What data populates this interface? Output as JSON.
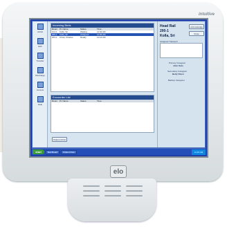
{
  "device": {
    "brand": "elo",
    "model_label": "intuitive"
  },
  "sidebar": {
    "items": [
      {
        "label": "Admit"
      },
      {
        "label": "Edit"
      },
      {
        "label": "Transfer"
      },
      {
        "label": "Discharge"
      },
      {
        "label": "Census"
      },
      {
        "label": "Help"
      }
    ]
  },
  "upper_pane": {
    "header": "Incoming Beds",
    "columns": [
      "Room",
      "Pt. Name",
      "Status",
      "Time"
    ],
    "rows": [
      [
        "101-1",
        "Kolla, Sri",
        "Waiting",
        "11:02 AM"
      ],
      [
        "200-1",
        "Kolla, Sri",
        "Assigned",
        "11:05 AM"
      ],
      [
        "201-1",
        "Chow, Charles",
        "Ready",
        "11:14 AM"
      ]
    ],
    "selected_row": 1
  },
  "lower_pane": {
    "header": "Encounter List",
    "columns": [
      "Room",
      "Pt. Name",
      "Status",
      "Time"
    ]
  },
  "bottom_button": "Patient Admit",
  "detail": {
    "unit": "Head Rail",
    "bed": "200-1",
    "patient": "Kolla, Sri",
    "acknowledge_button": "Acknowledge",
    "close_button": "Close",
    "assigned_label": "Assigned Transport",
    "primary_label": "Primary Caregiver",
    "primary_name": "John Kato",
    "secondary_label": "Secondary Caregiver",
    "secondary_name": "Betty Olsen",
    "backup_label": "Backup Caregiver"
  },
  "taskbar": {
    "start": "start",
    "tasks": [
      "Bed Board",
      "Patient Flow"
    ],
    "clock": "11:15 AM"
  }
}
